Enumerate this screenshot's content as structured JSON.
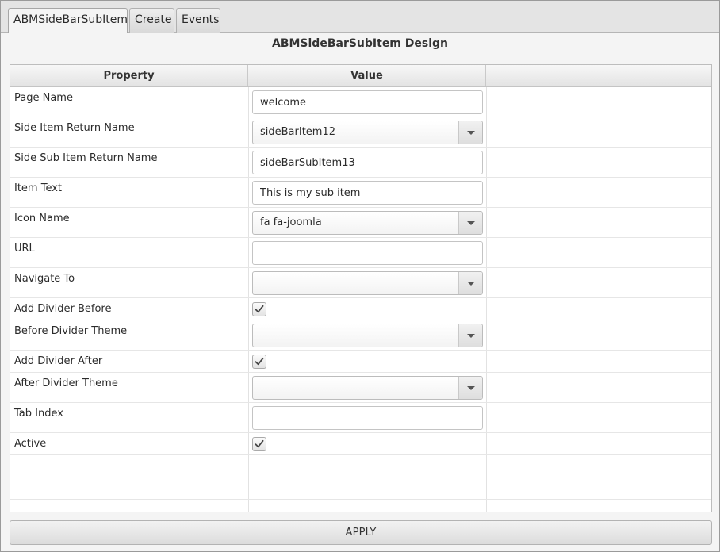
{
  "tabs": [
    {
      "label": "ABMSideBarSubItem",
      "active": true
    },
    {
      "label": "Create",
      "active": false
    },
    {
      "label": "Events",
      "active": false
    }
  ],
  "design_title": "ABMSideBarSubItem Design",
  "table": {
    "headers": {
      "property": "Property",
      "value": "Value",
      "extra": ""
    },
    "rows": [
      {
        "label": "Page Name",
        "type": "text",
        "value": "welcome"
      },
      {
        "label": "Side Item Return Name",
        "type": "combo",
        "value": "sideBarItem12"
      },
      {
        "label": "Side Sub Item Return Name",
        "type": "text",
        "value": "sideBarSubItem13"
      },
      {
        "label": "Item Text",
        "type": "text",
        "value": "This is my sub item"
      },
      {
        "label": "Icon Name",
        "type": "combo",
        "value": "fa fa-joomla"
      },
      {
        "label": "URL",
        "type": "text",
        "value": ""
      },
      {
        "label": "Navigate To",
        "type": "combo",
        "value": ""
      },
      {
        "label": "Add Divider Before",
        "type": "checkbox",
        "checked": true
      },
      {
        "label": "Before Divider Theme",
        "type": "combo",
        "value": ""
      },
      {
        "label": "Add Divider After",
        "type": "checkbox",
        "checked": true
      },
      {
        "label": "After Divider Theme",
        "type": "combo",
        "value": ""
      },
      {
        "label": "Tab Index",
        "type": "text",
        "value": ""
      },
      {
        "label": "Active",
        "type": "checkbox",
        "checked": true
      }
    ]
  },
  "apply_label": "APPLY"
}
